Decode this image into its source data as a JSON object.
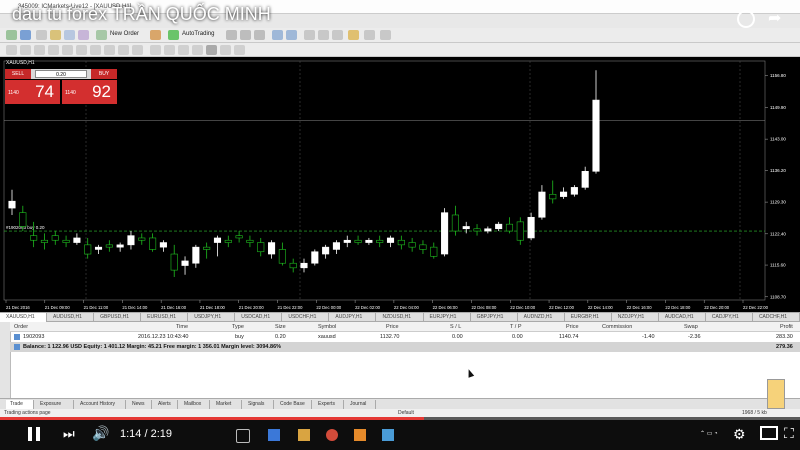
{
  "window": {
    "title": "345009: ICMarkets-Live12 - [XAUUSD,H1]"
  },
  "video": {
    "title": "dau tu forex TRẦN QUỐC MINH",
    "current_time": "1:14",
    "duration": "2:19",
    "progress": 0.53
  },
  "toolbar": {
    "new_order": "New Order",
    "auto_trading": "AutoTrading"
  },
  "chart": {
    "header": "XAUUSD,H1",
    "order_line_label": "#1902093 buy 0.20",
    "y_ticks": [
      "1156.80",
      "1149.90",
      "1143.00",
      "1136.20",
      "1129.30",
      "1122.40",
      "1115.60",
      "1108.70"
    ],
    "x_ticks": [
      "21 Dec 2016",
      "21 Dec 09:00",
      "21 Dec 11:00",
      "21 Dec 14:00",
      "21 Dec 16:00",
      "21 Dec 18:00",
      "21 Dec 20:00",
      "21 Dec 22:00",
      "22 Dec 00:00",
      "22 Dec 02:00",
      "22 Dec 04:00",
      "22 Dec 06:00",
      "22 Dec 08:00",
      "22 Dec 10:00",
      "22 Dec 12:00",
      "22 Dec 14:00",
      "22 Dec 16:00",
      "22 Dec 18:00",
      "22 Dec 20:00",
      "22 Dec 22:00"
    ]
  },
  "one_click": {
    "sell": "SELL",
    "buy": "BUY",
    "lot": "0.20",
    "sell_small": "1140",
    "sell_big": "74",
    "buy_small": "1140",
    "buy_big": "92"
  },
  "symbol_tabs": [
    "XAUUSD,H1",
    "AUDUSD,H1",
    "GBPUSD,H1",
    "EURUSD,H1",
    "USDJPY,H1",
    "USDCAD,H1",
    "USDCHF,H1",
    "AUDJPY,H1",
    "NZDUSD,H1",
    "EURJPY,H1",
    "GBPJPY,H1",
    "AUDNZD,H1",
    "EURGBP,H1",
    "NZDJPY,H1",
    "AUDCAD,H1",
    "CADJPY,H1",
    "CADCHF,H1"
  ],
  "terminal": {
    "headers": {
      "order": "Order",
      "time": "Time",
      "type": "Type",
      "size": "Size",
      "symbol": "Symbol",
      "price": "Price",
      "sl": "S / L",
      "tp": "T / P",
      "price2": "Price",
      "commission": "Commission",
      "swap": "Swap",
      "profit": "Profit"
    },
    "row": {
      "order": "1902093",
      "time": "2016.12.23 10:43:40",
      "type": "buy",
      "size": "0.20",
      "symbol": "xauusd",
      "price": "1132.70",
      "sl": "0.00",
      "tp": "0.00",
      "price2": "1140.74",
      "commission": "-1.40",
      "swap": "-2.36",
      "profit": "283.30"
    },
    "balance_line": "Balance: 1 122.96 USD  Equity: 1 401.12  Margin: 45.21  Free margin: 1 356.01  Margin level: 3094.86%",
    "balance_profit": "279.36"
  },
  "terminal_tabs": [
    "Trade",
    "Exposure",
    "Account History",
    "News",
    "Alerts",
    "Mailbox",
    "Market",
    "Signals",
    "Code Base",
    "Experts",
    "Journal"
  ],
  "status": {
    "left": "Trading actions page",
    "center": "Default",
    "right": "1968 / 5 kb"
  },
  "colors": {
    "chart_bg": "#000000",
    "bull": "#ffffff",
    "bear": "#1fbf1f",
    "sell": "#d32f2f",
    "progress": "#e53935"
  },
  "chart_data": {
    "type": "candlestick",
    "title": "XAUUSD,H1",
    "ylim": [
      1108,
      1160
    ],
    "candles": [
      {
        "o": 1128.0,
        "h": 1132.0,
        "c": 1129.5,
        "l": 1126.5
      },
      {
        "o": 1127.0,
        "h": 1128.5,
        "c": 1124.0,
        "l": 1123.0
      },
      {
        "o": 1122.0,
        "h": 1125.0,
        "c": 1121.0,
        "l": 1119.5
      },
      {
        "o": 1121.0,
        "h": 1122.5,
        "c": 1120.5,
        "l": 1119.0
      },
      {
        "o": 1122.0,
        "h": 1123.0,
        "c": 1121.0,
        "l": 1120.0
      },
      {
        "o": 1121.0,
        "h": 1122.0,
        "c": 1120.5,
        "l": 1119.5
      },
      {
        "o": 1120.5,
        "h": 1122.5,
        "c": 1121.5,
        "l": 1120.0
      },
      {
        "o": 1120.0,
        "h": 1121.5,
        "c": 1118.0,
        "l": 1117.0
      },
      {
        "o": 1119.0,
        "h": 1120.0,
        "c": 1119.5,
        "l": 1118.0
      },
      {
        "o": 1120.0,
        "h": 1121.0,
        "c": 1119.5,
        "l": 1118.5
      },
      {
        "o": 1119.5,
        "h": 1120.5,
        "c": 1120.0,
        "l": 1118.5
      },
      {
        "o": 1120.0,
        "h": 1123.0,
        "c": 1122.0,
        "l": 1119.0
      },
      {
        "o": 1121.5,
        "h": 1122.5,
        "c": 1121.0,
        "l": 1120.0
      },
      {
        "o": 1121.5,
        "h": 1122.5,
        "c": 1119.0,
        "l": 1118.5
      },
      {
        "o": 1119.5,
        "h": 1121.0,
        "c": 1120.5,
        "l": 1118.5
      },
      {
        "o": 1118.0,
        "h": 1120.0,
        "c": 1114.5,
        "l": 1113.0
      },
      {
        "o": 1115.5,
        "h": 1117.5,
        "c": 1116.5,
        "l": 1113.5
      },
      {
        "o": 1116.0,
        "h": 1120.0,
        "c": 1119.5,
        "l": 1115.0
      },
      {
        "o": 1119.5,
        "h": 1120.5,
        "c": 1119.0,
        "l": 1117.0
      },
      {
        "o": 1120.5,
        "h": 1122.0,
        "c": 1121.5,
        "l": 1117.5
      },
      {
        "o": 1121.0,
        "h": 1122.0,
        "c": 1120.5,
        "l": 1119.5
      },
      {
        "o": 1122.0,
        "h": 1123.0,
        "c": 1121.5,
        "l": 1120.5
      },
      {
        "o": 1121.0,
        "h": 1122.0,
        "c": 1120.5,
        "l": 1119.5
      },
      {
        "o": 1120.5,
        "h": 1121.5,
        "c": 1118.5,
        "l": 1117.5
      },
      {
        "o": 1118.0,
        "h": 1121.0,
        "c": 1120.5,
        "l": 1117.0
      },
      {
        "o": 1119.0,
        "h": 1120.5,
        "c": 1116.0,
        "l": 1115.5
      },
      {
        "o": 1116.0,
        "h": 1117.0,
        "c": 1115.0,
        "l": 1114.0
      },
      {
        "o": 1115.0,
        "h": 1117.0,
        "c": 1116.0,
        "l": 1114.0
      },
      {
        "o": 1116.0,
        "h": 1119.0,
        "c": 1118.5,
        "l": 1115.5
      },
      {
        "o": 1118.0,
        "h": 1120.0,
        "c": 1119.5,
        "l": 1117.0
      },
      {
        "o": 1119.0,
        "h": 1121.0,
        "c": 1120.5,
        "l": 1118.0
      },
      {
        "o": 1120.5,
        "h": 1122.0,
        "c": 1121.0,
        "l": 1119.5
      },
      {
        "o": 1121.0,
        "h": 1122.0,
        "c": 1120.5,
        "l": 1120.0
      },
      {
        "o": 1120.5,
        "h": 1121.5,
        "c": 1121.0,
        "l": 1120.0
      },
      {
        "o": 1121.0,
        "h": 1122.0,
        "c": 1120.5,
        "l": 1119.5
      },
      {
        "o": 1120.5,
        "h": 1122.0,
        "c": 1121.5,
        "l": 1119.5
      },
      {
        "o": 1121.0,
        "h": 1122.0,
        "c": 1120.0,
        "l": 1119.0
      },
      {
        "o": 1120.5,
        "h": 1121.5,
        "c": 1119.5,
        "l": 1118.5
      },
      {
        "o": 1120.0,
        "h": 1121.0,
        "c": 1119.0,
        "l": 1118.0
      },
      {
        "o": 1119.5,
        "h": 1120.5,
        "c": 1117.5,
        "l": 1117.0
      },
      {
        "o": 1118.0,
        "h": 1128.0,
        "c": 1127.0,
        "l": 1117.5
      },
      {
        "o": 1126.5,
        "h": 1128.5,
        "c": 1123.0,
        "l": 1122.0
      },
      {
        "o": 1123.5,
        "h": 1125.0,
        "c": 1124.0,
        "l": 1122.5
      },
      {
        "o": 1123.5,
        "h": 1124.5,
        "c": 1123.0,
        "l": 1122.0
      },
      {
        "o": 1123.0,
        "h": 1124.0,
        "c": 1123.5,
        "l": 1122.5
      },
      {
        "o": 1123.5,
        "h": 1125.0,
        "c": 1124.5,
        "l": 1123.0
      },
      {
        "o": 1124.5,
        "h": 1126.0,
        "c": 1123.0,
        "l": 1122.5
      },
      {
        "o": 1125.0,
        "h": 1126.0,
        "c": 1121.0,
        "l": 1120.0
      },
      {
        "o": 1121.5,
        "h": 1127.0,
        "c": 1126.0,
        "l": 1121.0
      },
      {
        "o": 1126.0,
        "h": 1133.0,
        "c": 1131.5,
        "l": 1125.5
      },
      {
        "o": 1131.0,
        "h": 1134.0,
        "c": 1130.0,
        "l": 1129.0
      },
      {
        "o": 1130.5,
        "h": 1132.5,
        "c": 1131.5,
        "l": 1130.0
      },
      {
        "o": 1131.0,
        "h": 1133.0,
        "c": 1132.5,
        "l": 1130.5
      },
      {
        "o": 1132.5,
        "h": 1137.0,
        "c": 1136.0,
        "l": 1132.0
      },
      {
        "o": 1136.0,
        "h": 1158.0,
        "c": 1151.5,
        "l": 1135.5
      }
    ]
  }
}
